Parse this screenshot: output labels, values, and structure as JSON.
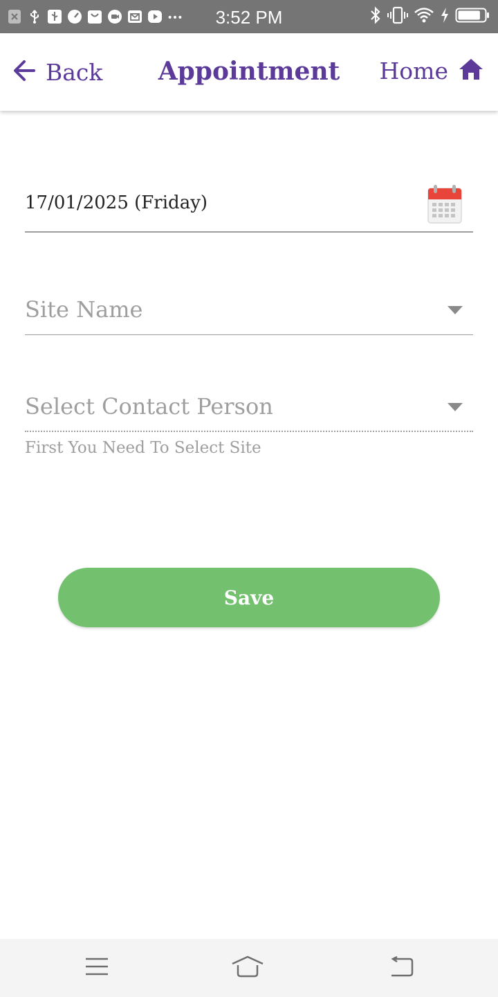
{
  "status_bar": {
    "time": "3:52 PM",
    "left_icons": [
      "close-notification-icon",
      "usb-icon",
      "usb-debug-icon",
      "gauge-icon",
      "shopping-bag-icon",
      "chat-icon",
      "mail-icon",
      "youtube-icon",
      "more-dots-icon"
    ],
    "right_icons": [
      "bluetooth-icon",
      "vibrate-icon",
      "wifi-icon",
      "charging-bolt-icon",
      "battery-icon"
    ],
    "battery_level": 0.85
  },
  "app_bar": {
    "back_label": "Back",
    "title": "Appointment",
    "home_label": "Home"
  },
  "form": {
    "date_value": "17/01/2025 (Friday)",
    "site_placeholder": "Site Name",
    "contact_placeholder": "Select Contact Person",
    "contact_helper": "First You Need To Select Site",
    "save_label": "Save"
  },
  "nav_bar": {
    "buttons": [
      "menu-icon",
      "home-nav-icon",
      "back-nav-icon"
    ]
  },
  "colors": {
    "accent": "#5b3a99",
    "save_button": "#73c16e",
    "status_bar": "#757575",
    "placeholder": "#9e9e9e",
    "calendar_red": "#e8443a"
  }
}
